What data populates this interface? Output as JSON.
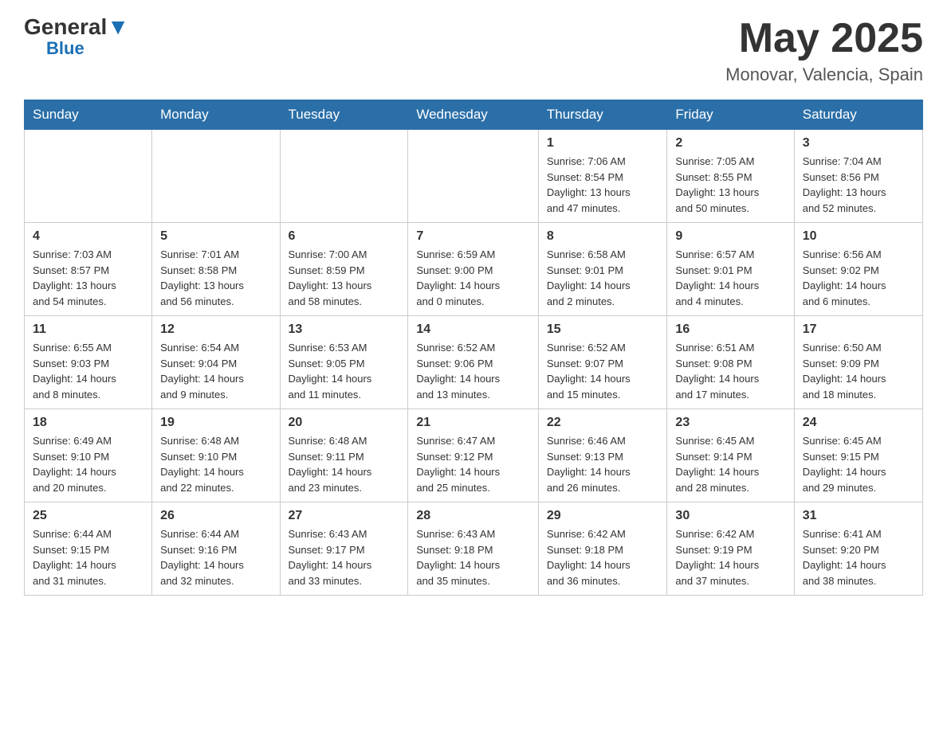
{
  "header": {
    "logo_general": "General",
    "logo_blue": "Blue",
    "month_year": "May 2025",
    "location": "Monovar, Valencia, Spain"
  },
  "days_of_week": [
    "Sunday",
    "Monday",
    "Tuesday",
    "Wednesday",
    "Thursday",
    "Friday",
    "Saturday"
  ],
  "weeks": [
    [
      {
        "day": "",
        "info": ""
      },
      {
        "day": "",
        "info": ""
      },
      {
        "day": "",
        "info": ""
      },
      {
        "day": "",
        "info": ""
      },
      {
        "day": "1",
        "info": "Sunrise: 7:06 AM\nSunset: 8:54 PM\nDaylight: 13 hours\nand 47 minutes."
      },
      {
        "day": "2",
        "info": "Sunrise: 7:05 AM\nSunset: 8:55 PM\nDaylight: 13 hours\nand 50 minutes."
      },
      {
        "day": "3",
        "info": "Sunrise: 7:04 AM\nSunset: 8:56 PM\nDaylight: 13 hours\nand 52 minutes."
      }
    ],
    [
      {
        "day": "4",
        "info": "Sunrise: 7:03 AM\nSunset: 8:57 PM\nDaylight: 13 hours\nand 54 minutes."
      },
      {
        "day": "5",
        "info": "Sunrise: 7:01 AM\nSunset: 8:58 PM\nDaylight: 13 hours\nand 56 minutes."
      },
      {
        "day": "6",
        "info": "Sunrise: 7:00 AM\nSunset: 8:59 PM\nDaylight: 13 hours\nand 58 minutes."
      },
      {
        "day": "7",
        "info": "Sunrise: 6:59 AM\nSunset: 9:00 PM\nDaylight: 14 hours\nand 0 minutes."
      },
      {
        "day": "8",
        "info": "Sunrise: 6:58 AM\nSunset: 9:01 PM\nDaylight: 14 hours\nand 2 minutes."
      },
      {
        "day": "9",
        "info": "Sunrise: 6:57 AM\nSunset: 9:01 PM\nDaylight: 14 hours\nand 4 minutes."
      },
      {
        "day": "10",
        "info": "Sunrise: 6:56 AM\nSunset: 9:02 PM\nDaylight: 14 hours\nand 6 minutes."
      }
    ],
    [
      {
        "day": "11",
        "info": "Sunrise: 6:55 AM\nSunset: 9:03 PM\nDaylight: 14 hours\nand 8 minutes."
      },
      {
        "day": "12",
        "info": "Sunrise: 6:54 AM\nSunset: 9:04 PM\nDaylight: 14 hours\nand 9 minutes."
      },
      {
        "day": "13",
        "info": "Sunrise: 6:53 AM\nSunset: 9:05 PM\nDaylight: 14 hours\nand 11 minutes."
      },
      {
        "day": "14",
        "info": "Sunrise: 6:52 AM\nSunset: 9:06 PM\nDaylight: 14 hours\nand 13 minutes."
      },
      {
        "day": "15",
        "info": "Sunrise: 6:52 AM\nSunset: 9:07 PM\nDaylight: 14 hours\nand 15 minutes."
      },
      {
        "day": "16",
        "info": "Sunrise: 6:51 AM\nSunset: 9:08 PM\nDaylight: 14 hours\nand 17 minutes."
      },
      {
        "day": "17",
        "info": "Sunrise: 6:50 AM\nSunset: 9:09 PM\nDaylight: 14 hours\nand 18 minutes."
      }
    ],
    [
      {
        "day": "18",
        "info": "Sunrise: 6:49 AM\nSunset: 9:10 PM\nDaylight: 14 hours\nand 20 minutes."
      },
      {
        "day": "19",
        "info": "Sunrise: 6:48 AM\nSunset: 9:10 PM\nDaylight: 14 hours\nand 22 minutes."
      },
      {
        "day": "20",
        "info": "Sunrise: 6:48 AM\nSunset: 9:11 PM\nDaylight: 14 hours\nand 23 minutes."
      },
      {
        "day": "21",
        "info": "Sunrise: 6:47 AM\nSunset: 9:12 PM\nDaylight: 14 hours\nand 25 minutes."
      },
      {
        "day": "22",
        "info": "Sunrise: 6:46 AM\nSunset: 9:13 PM\nDaylight: 14 hours\nand 26 minutes."
      },
      {
        "day": "23",
        "info": "Sunrise: 6:45 AM\nSunset: 9:14 PM\nDaylight: 14 hours\nand 28 minutes."
      },
      {
        "day": "24",
        "info": "Sunrise: 6:45 AM\nSunset: 9:15 PM\nDaylight: 14 hours\nand 29 minutes."
      }
    ],
    [
      {
        "day": "25",
        "info": "Sunrise: 6:44 AM\nSunset: 9:15 PM\nDaylight: 14 hours\nand 31 minutes."
      },
      {
        "day": "26",
        "info": "Sunrise: 6:44 AM\nSunset: 9:16 PM\nDaylight: 14 hours\nand 32 minutes."
      },
      {
        "day": "27",
        "info": "Sunrise: 6:43 AM\nSunset: 9:17 PM\nDaylight: 14 hours\nand 33 minutes."
      },
      {
        "day": "28",
        "info": "Sunrise: 6:43 AM\nSunset: 9:18 PM\nDaylight: 14 hours\nand 35 minutes."
      },
      {
        "day": "29",
        "info": "Sunrise: 6:42 AM\nSunset: 9:18 PM\nDaylight: 14 hours\nand 36 minutes."
      },
      {
        "day": "30",
        "info": "Sunrise: 6:42 AM\nSunset: 9:19 PM\nDaylight: 14 hours\nand 37 minutes."
      },
      {
        "day": "31",
        "info": "Sunrise: 6:41 AM\nSunset: 9:20 PM\nDaylight: 14 hours\nand 38 minutes."
      }
    ]
  ]
}
